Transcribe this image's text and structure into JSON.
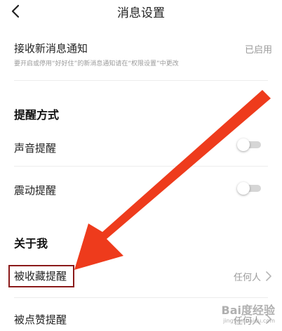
{
  "header": {
    "title": "消息设置"
  },
  "receive": {
    "label": "接收新消息通知",
    "status": "已启用",
    "note": "要开启或停用“好好住”的新消息通知请在“权限设置”中更改"
  },
  "reminder_section": {
    "title": "提醒方式",
    "items": [
      {
        "label": "声音提醒",
        "enabled": false
      },
      {
        "label": "震动提醒",
        "enabled": false
      }
    ]
  },
  "about_section": {
    "title": "关于我",
    "items": [
      {
        "label": "被收藏提醒",
        "value": "任何人"
      },
      {
        "label": "被点赞提醒",
        "value": "任何人"
      }
    ]
  },
  "watermark": {
    "main": "Bai度经验",
    "sub": "jingyan.baidu.com"
  },
  "colors": {
    "arrow": "#ee3b1c",
    "highlight_border": "#8b1a1a",
    "toggle_track": "#d6d6d6"
  }
}
